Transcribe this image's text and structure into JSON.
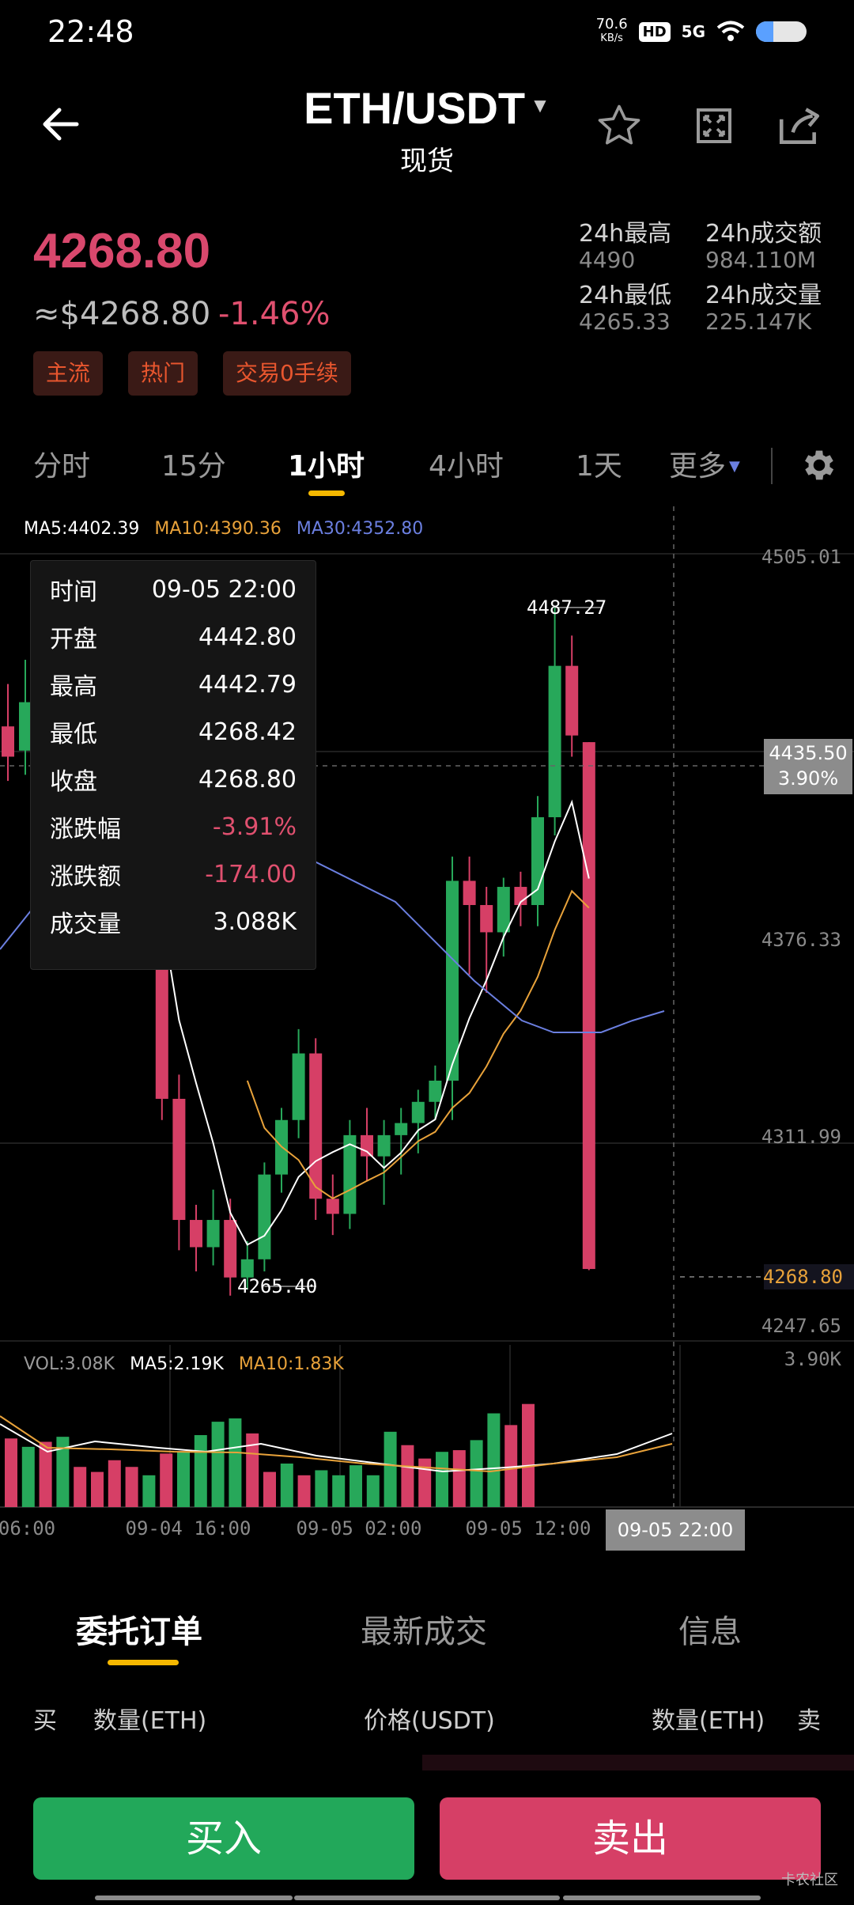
{
  "status": {
    "time": "22:48",
    "speed_value": "70.6",
    "speed_unit": "KB/s",
    "hd": "HD",
    "network": "5G"
  },
  "header": {
    "pair": "ETH/USDT",
    "market": "现货"
  },
  "price": {
    "last": "4268.80",
    "usd": "≈$4268.80",
    "change": "-1.46%"
  },
  "tags": [
    "主流",
    "热门",
    "交易0手续"
  ],
  "stats": {
    "high_label": "24h最高",
    "high": "4490",
    "low_label": "24h最低",
    "low": "4265.33",
    "turnover_label": "24h成交额",
    "turnover": "984.110M",
    "volume_label": "24h成交量",
    "volume": "225.147K"
  },
  "tabs": [
    "分时",
    "15分",
    "1小时",
    "4小时",
    "1天",
    "更多"
  ],
  "ma_legend": {
    "ma5": "MA5:4402.39",
    "ma10": "MA10:4390.36",
    "ma30": "MA30:4352.80"
  },
  "vol_legend": {
    "vol": "VOL:3.08K",
    "ma5": "MA5:2.19K",
    "ma10": "MA10:1.83K"
  },
  "tooltip": {
    "rows": [
      {
        "k": "时间",
        "v": "09-05 22:00"
      },
      {
        "k": "开盘",
        "v": "4442.80"
      },
      {
        "k": "最高",
        "v": "4442.79"
      },
      {
        "k": "最低",
        "v": "4268.42"
      },
      {
        "k": "收盘",
        "v": "4268.80"
      },
      {
        "k": "涨跌幅",
        "v": "-3.91%"
      },
      {
        "k": "涨跌额",
        "v": "-174.00"
      },
      {
        "k": "成交量",
        "v": "3.088K"
      }
    ]
  },
  "crosshair": {
    "price": "4435.50",
    "pct": "3.90%",
    "time": "09-05 22:00"
  },
  "bottom_tabs": [
    "委托订单",
    "最新成交",
    "信息"
  ],
  "orderbook": {
    "buy": "买",
    "qty_left": "数量(ETH)",
    "price": "价格(USDT)",
    "qty_right": "数量(ETH)",
    "sell": "卖"
  },
  "actions": {
    "buy": "买入",
    "sell": "卖出"
  },
  "watermark": "卡农社区",
  "colors": {
    "up": "#27a85a",
    "down": "#d63f66",
    "ma5": "#ffffff",
    "ma10": "#e8a23a",
    "ma30": "#6b7fe0",
    "accent": "#f5b800"
  },
  "chart_data": {
    "type": "candlestick",
    "interval": "1小时",
    "y_ticks": [
      "4505.01",
      "4376.33",
      "4311.99",
      "4247.65"
    ],
    "x_ticks": [
      "06:00",
      "09-04  16:00",
      "09-05  02:00",
      "09-05  12:00"
    ],
    "ylim": [
      4247.65,
      4505.01
    ],
    "high_label": "4487.27",
    "low_label": "4265.40",
    "last_price_label": "4268.80",
    "vol_axis_max": "3.90K",
    "candles": [
      [
        4448,
        4462,
        4430,
        4438
      ],
      [
        4440,
        4470,
        4432,
        4456
      ],
      [
        4400,
        4405,
        4372,
        4380
      ],
      [
        4380,
        4392,
        4365,
        4384
      ],
      [
        4384,
        4388,
        4372,
        4381
      ],
      [
        4395,
        4402,
        4318,
        4325
      ],
      [
        4325,
        4333,
        4275,
        4285
      ],
      [
        4285,
        4290,
        4268,
        4276
      ],
      [
        4276,
        4295,
        4270,
        4285
      ],
      [
        4285,
        4292,
        4260,
        4266
      ],
      [
        4266,
        4278,
        4262,
        4272
      ],
      [
        4272,
        4304,
        4268,
        4300
      ],
      [
        4300,
        4322,
        4294,
        4318
      ],
      [
        4318,
        4348,
        4312,
        4340
      ],
      [
        4340,
        4345,
        4285,
        4292
      ],
      [
        4292,
        4300,
        4280,
        4287
      ],
      [
        4287,
        4318,
        4282,
        4313
      ],
      [
        4313,
        4322,
        4298,
        4306
      ],
      [
        4306,
        4318,
        4290,
        4313
      ],
      [
        4313,
        4322,
        4300,
        4317
      ],
      [
        4317,
        4328,
        4307,
        4324
      ],
      [
        4324,
        4336,
        4318,
        4331
      ],
      [
        4331,
        4405,
        4318,
        4397
      ],
      [
        4397,
        4405,
        4366,
        4389
      ],
      [
        4389,
        4395,
        4360,
        4380
      ],
      [
        4380,
        4398,
        4372,
        4395
      ],
      [
        4395,
        4400,
        4382,
        4389
      ],
      [
        4389,
        4425,
        4382,
        4418
      ],
      [
        4418,
        4487.27,
        4412,
        4468
      ],
      [
        4468,
        4478,
        4438,
        4445
      ],
      [
        4442.8,
        4442.79,
        4268.42,
        4268.8
      ]
    ],
    "candles_note_keys": [
      "open",
      "high",
      "low",
      "close"
    ],
    "volumes": [
      2.05,
      1.8,
      1.95,
      2.1,
      1.2,
      1.05,
      1.4,
      1.2,
      0.95,
      1.6,
      1.65,
      2.15,
      2.55,
      2.65,
      2.2,
      1.05,
      1.3,
      0.95,
      1.1,
      0.95,
      1.25,
      0.95,
      2.25,
      1.85,
      1.45,
      1.65,
      1.7,
      2.0,
      2.8,
      2.45,
      3.08
    ]
  }
}
